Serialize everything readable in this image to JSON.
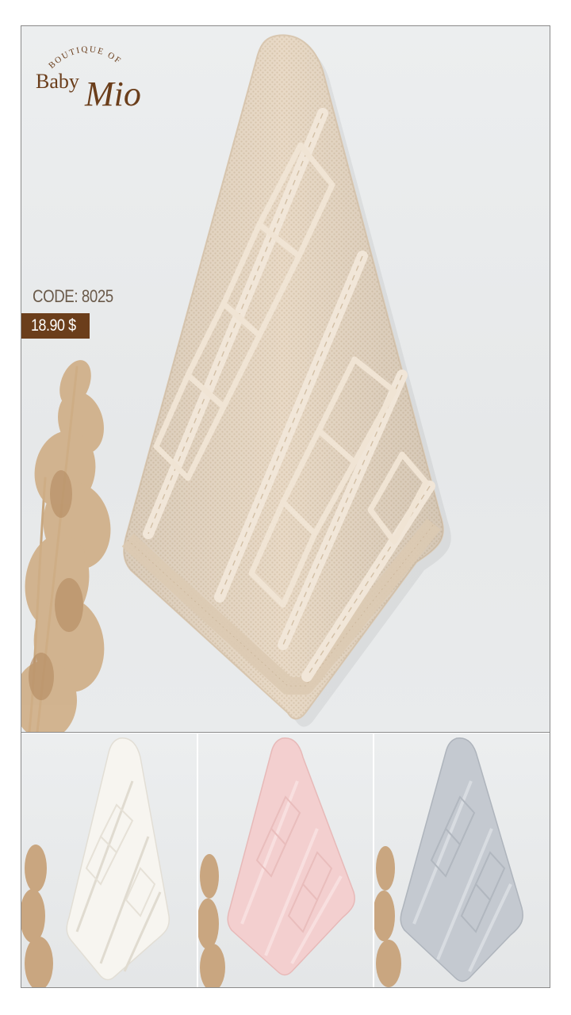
{
  "brand": {
    "tagline": "BOUTIQUE OF",
    "name_part1": "Baby",
    "name_part2": "Mio"
  },
  "product": {
    "code_label": "CODE: 8025",
    "price_label": "18.90 $"
  },
  "colors": {
    "brand_brown": "#6b3e1b",
    "beige_blanket": "#e6d6c2",
    "white_blanket": "#f6f4ef",
    "pink_blanket": "#f2cdcc",
    "grey_blanket": "#c3c8cf"
  },
  "variants": [
    {
      "name": "white"
    },
    {
      "name": "pink"
    },
    {
      "name": "grey"
    }
  ]
}
